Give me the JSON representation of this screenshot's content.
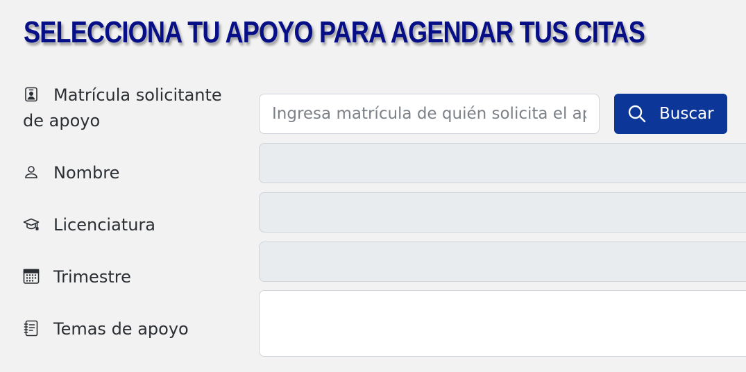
{
  "header": {
    "title": "SELECCIONA TU APOYO PARA AGENDAR TUS CITAS"
  },
  "form": {
    "matricula": {
      "label": "Matrícula solicitante de apoyo",
      "icon": "person-badge-icon",
      "placeholder": "Ingresa matrícula de quién solicita el apoyo",
      "value": ""
    },
    "buscar_button": {
      "label": "Buscar",
      "icon": "search-icon"
    },
    "nombre": {
      "label": "Nombre",
      "icon": "person-icon",
      "value": ""
    },
    "licenciatura": {
      "label": "Licenciatura",
      "icon": "mortarboard-icon",
      "value": ""
    },
    "trimestre": {
      "label": "Trimestre",
      "icon": "calendar-icon",
      "value": ""
    },
    "temas": {
      "label": "Temas de apoyo",
      "icon": "journal-text-icon",
      "value": ""
    }
  },
  "colors": {
    "title": "#060f86",
    "button_bg": "#0c3799",
    "page_bg": "#f2f2f2",
    "readonly_bg": "#e9ecef"
  }
}
